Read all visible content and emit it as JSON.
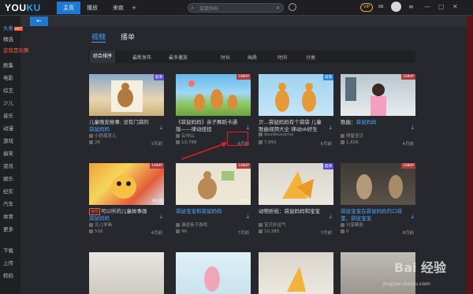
{
  "app": {
    "logo_a": "YOU",
    "logo_b": "KU"
  },
  "topbar": {
    "tabs": [
      {
        "label": "主页"
      },
      {
        "label": "播放"
      },
      {
        "label": "来疯"
      }
    ],
    "add_tab": "+",
    "search_placeholder": "袋鼠妈妈",
    "vip_label": "VIP"
  },
  "nav_back": "←",
  "sidebar": {
    "items": [
      {
        "label": "头条"
      },
      {
        "label": "精选"
      },
      {
        "label": "这就是街舞"
      },
      {
        "label": "剧集"
      },
      {
        "label": "电影"
      },
      {
        "label": "综艺"
      },
      {
        "label": "少儿"
      },
      {
        "label": "音乐"
      },
      {
        "label": "动漫"
      },
      {
        "label": "游戏"
      },
      {
        "label": "搞笑"
      },
      {
        "label": "资讯"
      },
      {
        "label": "娱乐"
      },
      {
        "label": "纪实"
      },
      {
        "label": "汽车"
      },
      {
        "label": "体育"
      },
      {
        "label": "更多"
      },
      {
        "label": "下载"
      },
      {
        "label": "上传"
      },
      {
        "label": "转码"
      }
    ],
    "hot_badge": "HOT"
  },
  "content_tabs": [
    {
      "label": "视频"
    },
    {
      "label": "播单"
    }
  ],
  "filters": [
    {
      "label": "综合排序"
    },
    {
      "label": "最新发布"
    },
    {
      "label": "最多播放"
    },
    {
      "label": "时长"
    },
    {
      "label": "画质"
    },
    {
      "label": "时间"
    },
    {
      "label": "分类"
    }
  ],
  "videos": [
    {
      "quality": "超清",
      "duration": "",
      "title1": "儿童晚安故事: 没有门袋的",
      "title2a": "袋",
      "title2b": "鼠妈妈",
      "uploader": "小奶瓶育儿",
      "views": "28",
      "ago": "3天前"
    },
    {
      "quality": "1080P",
      "duration": "",
      "title1": "《袋鼠妈妈》亲子舞蹈卡通",
      "title2a": "",
      "title2b": "版——律动扭扭",
      "uploader": "云中山",
      "views": "13,798",
      "ago": "6月前"
    },
    {
      "quality": "高清",
      "duration": "",
      "title1": "贝...袋鼠妈妈有个袋袋 儿童",
      "title2a": "",
      "title2b": "歌曲视频大全 律动ok好生",
      "uploader": "doudousunny",
      "views": "7,991",
      "ago": "6月前"
    },
    {
      "quality": "1080P",
      "duration": "",
      "title1": "歌曲：袋鼠妈妈",
      "title2a": "",
      "title2b": "",
      "uploader": "明星宝贝",
      "views": "1,826",
      "ago": "4月前"
    },
    {
      "quality": "1080P",
      "duration": "00:29",
      "title1": "可以听的儿童故事画",
      "title2a": "袋鼠妈妈",
      "title2b": "",
      "uploader": "贝儿学画",
      "views": "516",
      "ago": "4月前",
      "tag": "播放"
    },
    {
      "quality": "1080P",
      "duration": "33:35",
      "title1": "袋鼠宝宝和袋鼠妈妈",
      "title2a": "",
      "title2b": "",
      "uploader": "漫途亲子游戏",
      "views": "96",
      "ago": "7月前"
    },
    {
      "quality": "超清",
      "duration": "",
      "title1": "动物折纸：袋鼠妈妈和宝宝",
      "title2a": "",
      "title2b": "",
      "uploader": "宝贝好运气",
      "views": "10,385",
      "ago": "7月前"
    },
    {
      "quality": "1080P",
      "duration": "",
      "title1": "袋鼠宝宝在袋鼠妈妈的口袋",
      "title2a": "里，袋鼠宝宝",
      "title2b": "",
      "uploader": "分享精彩",
      "views": "0",
      "ago": "8月前"
    },
    {
      "quality": "",
      "duration": "",
      "title1": "",
      "title2a": "",
      "title2b": "",
      "uploader": "",
      "views": "",
      "ago": ""
    },
    {
      "quality": "",
      "duration": "",
      "title1": "",
      "title2a": "",
      "title2b": "",
      "uploader": "",
      "views": "",
      "ago": ""
    },
    {
      "quality": "",
      "duration": "",
      "title1": "",
      "title2a": "",
      "title2b": "",
      "uploader": "",
      "views": "",
      "ago": ""
    },
    {
      "quality": "",
      "duration": "",
      "title1": "",
      "title2a": "",
      "title2b": "",
      "uploader": "",
      "views": "",
      "ago": ""
    }
  ],
  "watermark": {
    "brand": "Bai 经验",
    "url": "jingyan.baidu.com"
  }
}
